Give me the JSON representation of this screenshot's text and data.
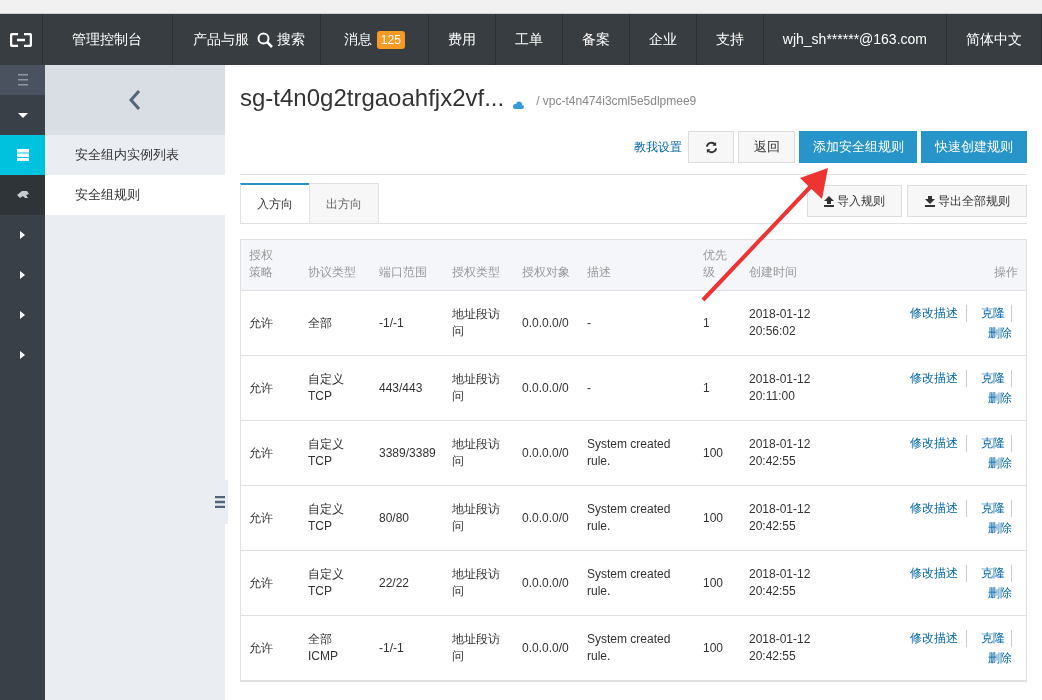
{
  "top_nav": {
    "items": [
      {
        "label": "管理控制台",
        "kind": "text"
      },
      {
        "label": "产品与服",
        "kind": "text"
      },
      {
        "label": "搜索",
        "kind": "search"
      },
      {
        "label": "消息",
        "kind": "badge",
        "badge": "125"
      },
      {
        "label": "费用",
        "kind": "text"
      },
      {
        "label": "工单",
        "kind": "text"
      },
      {
        "label": "备案",
        "kind": "text"
      },
      {
        "label": "企业",
        "kind": "text"
      },
      {
        "label": "支持",
        "kind": "text"
      },
      {
        "label": "wjh_sh******@163.com",
        "kind": "text"
      },
      {
        "label": "简体中文",
        "kind": "text"
      }
    ]
  },
  "icon_rail": [
    {
      "kind": "menu",
      "selected": false
    },
    {
      "kind": "down",
      "selected": false
    },
    {
      "kind": "server",
      "selected": true
    },
    {
      "kind": "plug",
      "selected": false
    },
    {
      "kind": "right",
      "selected": false
    },
    {
      "kind": "right",
      "selected": false
    },
    {
      "kind": "right",
      "selected": false
    },
    {
      "kind": "right",
      "selected": false
    }
  ],
  "sidebar": {
    "items": [
      {
        "label": "安全组内实例列表",
        "selected": false
      },
      {
        "label": "安全组规则",
        "selected": true
      }
    ]
  },
  "header": {
    "title": "sg-t4n0g2trgaoahfjx2vf...",
    "vpc": "/ vpc-t4n474i3cml5e5dlpmee9"
  },
  "actions": {
    "help_link": "教我设置",
    "back": "返回",
    "add_rule": "添加安全组规则",
    "quick_create": "快速创建规则"
  },
  "tabs": [
    {
      "label": "入方向",
      "selected": true
    },
    {
      "label": "出方向",
      "selected": false
    }
  ],
  "tools": {
    "import": "导入规则",
    "export": "导出全部规则"
  },
  "table": {
    "columns": [
      "授权策略",
      "协议类型",
      "端口范围",
      "授权类型",
      "授权对象",
      "描述",
      "优先级",
      "创建时间",
      "操作"
    ],
    "rows": [
      {
        "policy": "允许",
        "protocol": "全部",
        "port": "-1/-1",
        "auth_type": "地址段访问",
        "object": "0.0.0.0/0",
        "description": "-",
        "priority": "1",
        "created": "2018-01-12 20:56:02",
        "actions": [
          "修改描述",
          "克隆",
          "删除"
        ]
      },
      {
        "policy": "允许",
        "protocol": "自定义 TCP",
        "port": "443/443",
        "auth_type": "地址段访问",
        "object": "0.0.0.0/0",
        "description": "-",
        "priority": "1",
        "created": "2018-01-12 20:11:00",
        "actions": [
          "修改描述",
          "克隆",
          "删除"
        ]
      },
      {
        "policy": "允许",
        "protocol": "自定义 TCP",
        "port": "3389/3389",
        "auth_type": "地址段访问",
        "object": "0.0.0.0/0",
        "description": "System created rule.",
        "priority": "100",
        "created": "2018-01-12 20:42:55",
        "actions": [
          "修改描述",
          "克隆",
          "删除"
        ]
      },
      {
        "policy": "允许",
        "protocol": "自定义 TCP",
        "port": "80/80",
        "auth_type": "地址段访问",
        "object": "0.0.0.0/0",
        "description": "System created rule.",
        "priority": "100",
        "created": "2018-01-12 20:42:55",
        "actions": [
          "修改描述",
          "克隆",
          "删除"
        ]
      },
      {
        "policy": "允许",
        "protocol": "自定义 TCP",
        "port": "22/22",
        "auth_type": "地址段访问",
        "object": "0.0.0.0/0",
        "description": "System created rule.",
        "priority": "100",
        "created": "2018-01-12 20:42:55",
        "actions": [
          "修改描述",
          "克隆",
          "删除"
        ]
      },
      {
        "policy": "允许",
        "protocol": "全部 ICMP",
        "port": "-1/-1",
        "auth_type": "地址段访问",
        "object": "0.0.0.0/0",
        "description": "System created rule.",
        "priority": "100",
        "created": "2018-01-12 20:42:55",
        "actions": [
          "修改描述",
          "克隆",
          "删除"
        ]
      }
    ]
  }
}
